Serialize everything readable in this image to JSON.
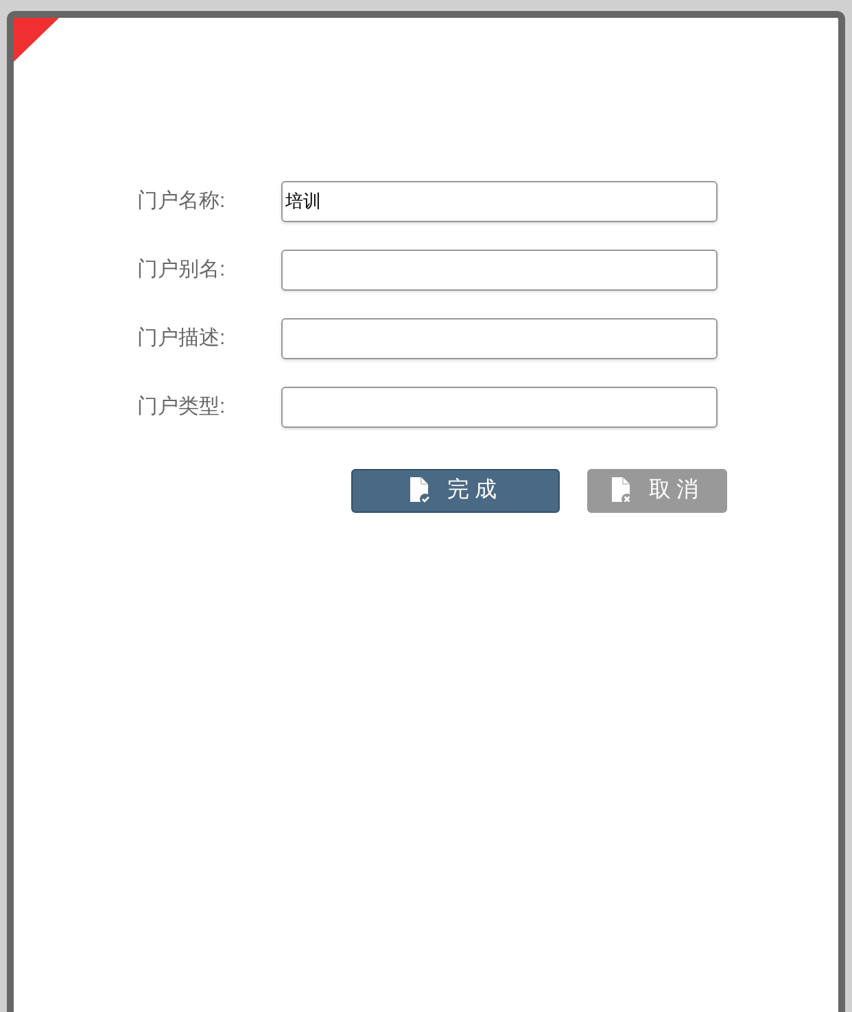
{
  "fields": [
    {
      "label": "门户名称:",
      "value": "培训"
    },
    {
      "label": "门户别名:"
    },
    {
      "label": "门户描述:"
    },
    {
      "label": "门户类型:"
    }
  ],
  "buttons": [
    {
      "label": "完成",
      "kind": "confirm"
    },
    {
      "label": "取消",
      "kind": "cancel"
    }
  ]
}
